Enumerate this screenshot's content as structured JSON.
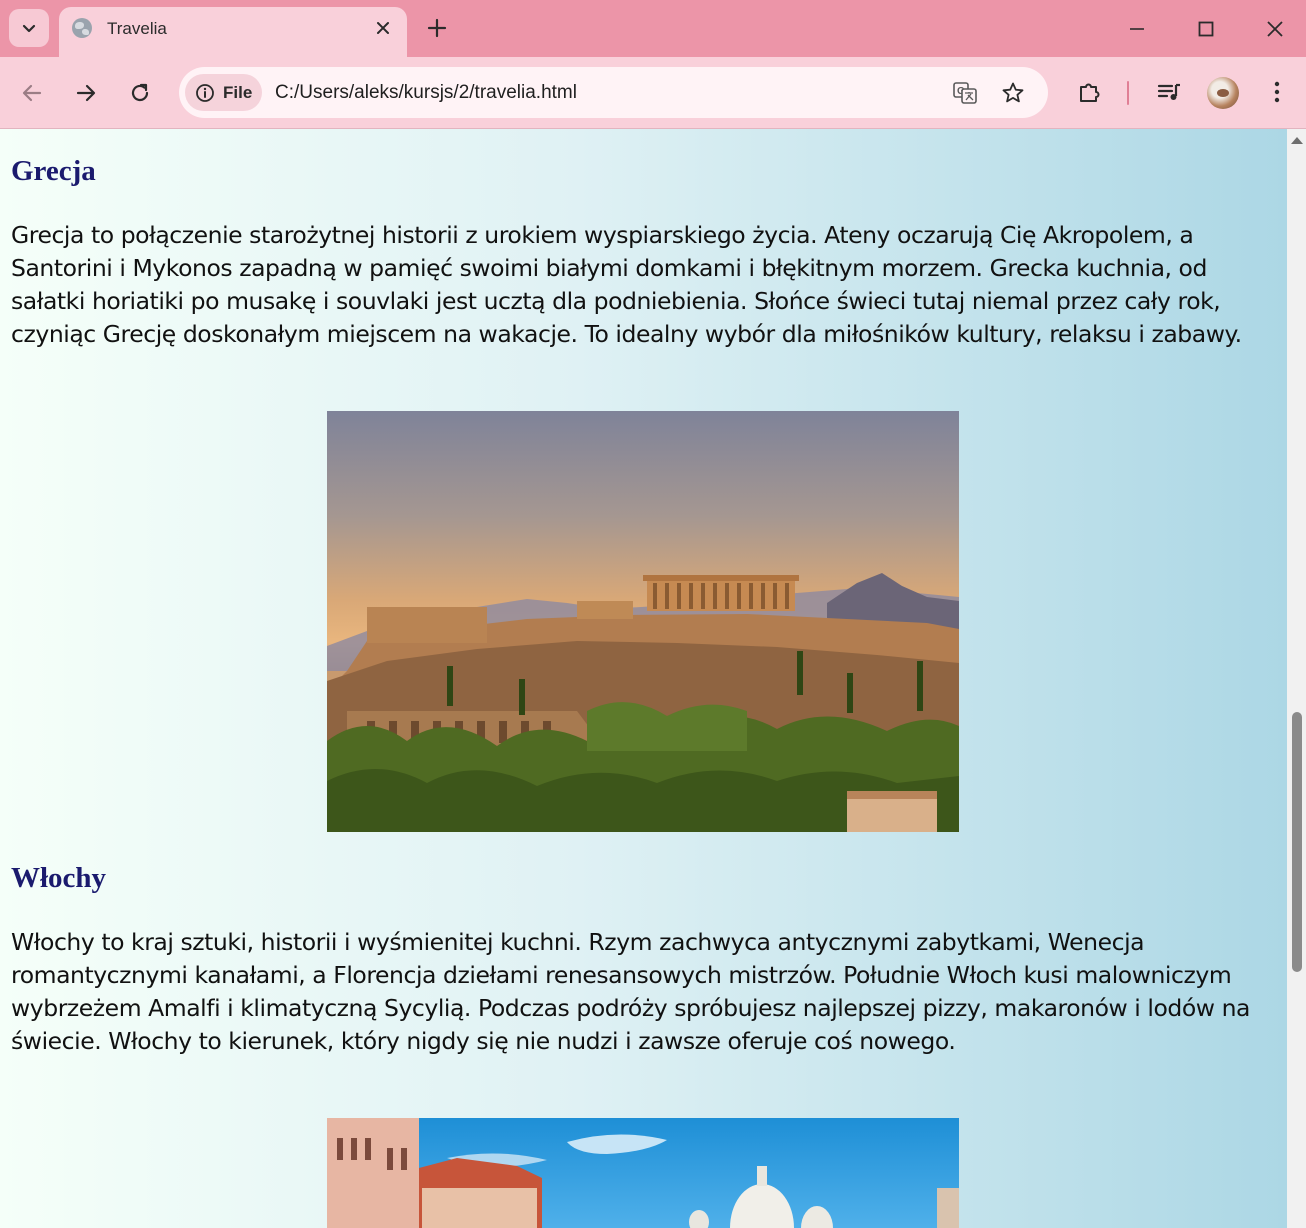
{
  "browser": {
    "tab_title": "Travelia",
    "url_scheme_label": "File",
    "url": "C:/Users/aleks/kursjs/2/travelia.html"
  },
  "page": {
    "sections": [
      {
        "heading": "Grecja",
        "text": "Grecja to połączenie starożytnej historii z urokiem wyspiarskiego życia. Ateny oczarują Cię Akropolem, a Santorini i Mykonos zapadną w pamięć swoimi białymi domkami i błękitnym morzem. Grecka kuchnia, od sałatki horiatiki po musakę i souvlaki jest ucztą dla podniebienia. Słońce świeci tutaj niemal przez cały rok, czyniąc Grecję doskonałym miejscem na wakacje. To idealny wybór dla miłośników kultury, relaksu i zabawy.",
        "image": "acropolis-athens"
      },
      {
        "heading": "Włochy",
        "text": "Włochy to kraj sztuki, historii i wyśmienitej kuchni. Rzym zachwyca antycznymi zabytkami, Wenecja romantycznymi kanałami, a Florencja dziełami renesansowych mistrzów. Południe Włoch kusi malowniczym wybrzeżem Amalfi i klimatyczną Sycylią. Podczas podróży spróbujesz najlepszej pizzy, makaronów i lodów na świecie. Włochy to kierunek, który nigdy się nie nudzi i zawsze oferuje coś nowego.",
        "image": "venice-grand-canal"
      }
    ]
  },
  "icons": [
    "tab-search-icon",
    "globe-icon",
    "close-icon",
    "plus-icon",
    "minimize-icon",
    "maximize-icon",
    "back-icon",
    "forward-icon",
    "reload-icon",
    "info-icon",
    "translate-icon",
    "star-icon",
    "extensions-icon",
    "media-icon",
    "menu-icon"
  ],
  "colors": {
    "tabbar": "#ec95a8",
    "toolbar": "#f9d0da",
    "heading": "#1b1b6e",
    "page_gradient_start": "#f5fff9",
    "page_gradient_end": "#acd7e5"
  }
}
